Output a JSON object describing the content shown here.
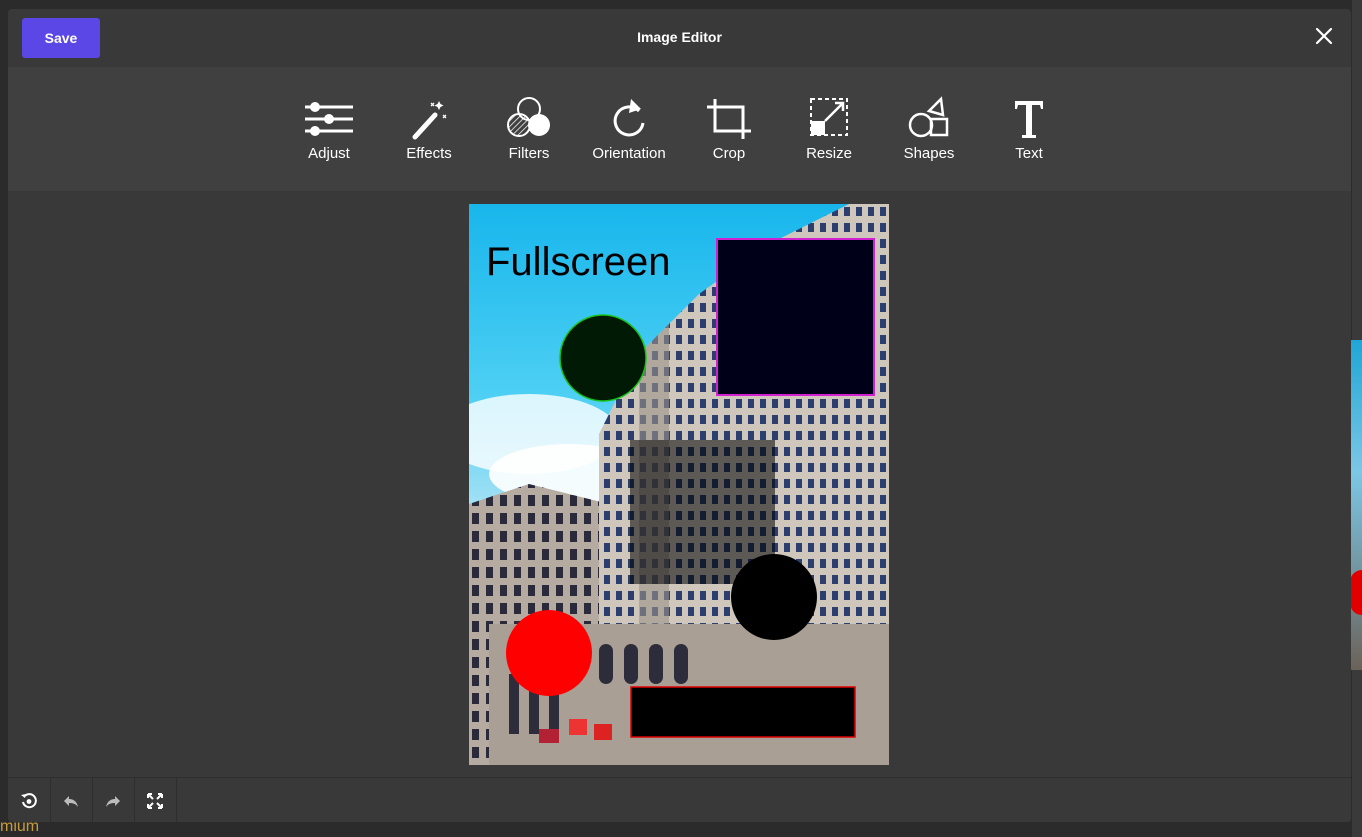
{
  "header": {
    "save_label": "Save",
    "title": "Image Editor"
  },
  "toolbar": {
    "tools": [
      {
        "label": "Adjust",
        "icon": "sliders-icon"
      },
      {
        "label": "Effects",
        "icon": "magic-wand-icon"
      },
      {
        "label": "Filters",
        "icon": "filters-icon"
      },
      {
        "label": "Orientation",
        "icon": "rotate-icon"
      },
      {
        "label": "Crop",
        "icon": "crop-icon"
      },
      {
        "label": "Resize",
        "icon": "resize-icon"
      },
      {
        "label": "Shapes",
        "icon": "shapes-icon"
      },
      {
        "label": "Text",
        "icon": "text-icon"
      }
    ]
  },
  "canvas": {
    "overlay_text": "Fullscreen"
  },
  "footer": {
    "buttons": [
      "reset-icon",
      "undo-icon",
      "redo-icon",
      "fullscreen-icon"
    ]
  },
  "background": {
    "partial_text": "mium"
  },
  "colors": {
    "accent": "#5b46e6",
    "modal_bg": "#393939",
    "toolbar_bg": "#404040"
  }
}
